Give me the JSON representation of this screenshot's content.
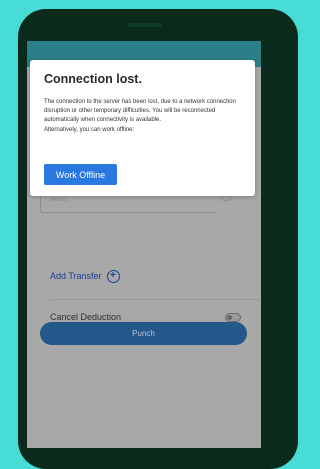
{
  "dialog": {
    "title": "Connection lost.",
    "message": "The connection to the server has been lost, due to a network connection disruption or other temporary difficulties. You will be reconnected automatically when connectivity is available.",
    "alternative": "Alternatively, you can work offline:",
    "button_label": "Work Offline"
  },
  "form": {
    "field_value": "None",
    "add_transfer_label": "Add Transfer",
    "cancel_deduction_label": "Cancel Deduction",
    "cancel_deduction_on": false,
    "punch_label": "Punch"
  },
  "colors": {
    "background": "#47dcd6",
    "accent": "#2979e0",
    "punch_button": "#24578a"
  }
}
